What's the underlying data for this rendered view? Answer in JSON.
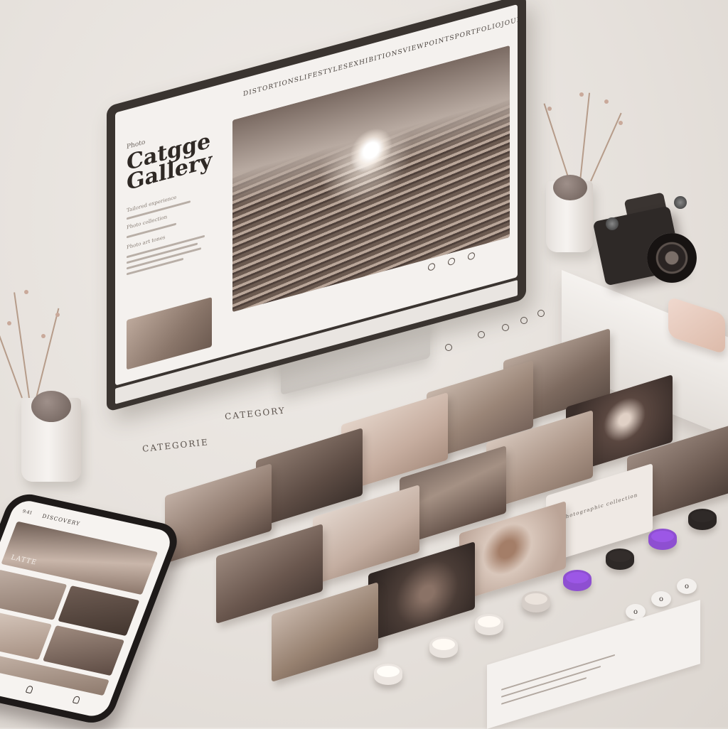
{
  "site": {
    "small_label": "Photo",
    "title": "Catgge Gallery",
    "nav": [
      "Distortions",
      "Lifestyles",
      "Exhibitions",
      "Viewpoints",
      "Portfolio",
      "Journeys"
    ],
    "side_labels": [
      "Tailored experience",
      "Photo collection",
      "Photo art tones"
    ]
  },
  "categories": {
    "label_left": "CATEGORIE",
    "label_center": "CATEGORY"
  },
  "card_note": "Photographic collection",
  "buttons": {
    "circle_icons": [
      "circle-icon",
      "circle-icon",
      "circle-icon"
    ],
    "swatch_colors": [
      "#e9e3de",
      "#d6cec8",
      "#8e4fd1",
      "#2e2927",
      "#8e4fd1",
      "#2b2624"
    ]
  },
  "phone": {
    "time": "9:41",
    "title": "DISCOVERY",
    "hero_word": "LATTE"
  },
  "colors": {
    "background": "#e9e5e1",
    "accent": "#8e4fd1",
    "frame": "#3a3430",
    "sepia": "#8a766a"
  }
}
